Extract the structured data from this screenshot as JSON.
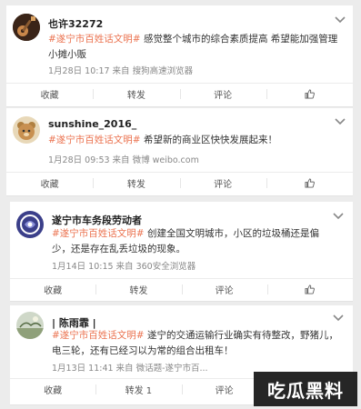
{
  "posts": [
    {
      "username": "也许32272",
      "tag": "#遂宁市百姓话文明#",
      "text": " 感觉整个城市的综合素质提高 希望能加强管理小摊小贩",
      "meta": "1月28日 10:17 来自 搜狗高速浏览器",
      "actions": {
        "favorite": "收藏",
        "repost": "转发",
        "comment": "评论"
      },
      "avatar_icon": "guitar-avatar-icon"
    },
    {
      "username": "sunshine_2016_",
      "tag": "#遂宁市百姓话文明#",
      "text": " 希望新的商业区快快发展起来！",
      "meta": "1月28日 09:53 来自 微博 weibo.com",
      "actions": {
        "favorite": "收藏",
        "repost": "转发",
        "comment": "评论"
      },
      "avatar_icon": "bear-avatar-icon"
    },
    {
      "username": "遂宁市车务段劳动者",
      "tag": "#遂宁市百姓话文明#",
      "text": " 创建全国文明城市，小区的垃圾桶还是偏少，还是存在乱丢垃圾的现象。",
      "meta": "1月14日 10:15 来自 360安全浏览器",
      "actions": {
        "favorite": "收藏",
        "repost": "转发",
        "comment": "评论"
      },
      "avatar_icon": "logo-avatar-icon"
    },
    {
      "username": "| 陈雨霏 |",
      "tag": "#遂宁市百姓话文明#",
      "text": " 遂宁的交通运输行业确实有待整改，野猪儿，电三轮，还有已经习以为常的组合出租车！",
      "meta": "1月13日 11:41 来自 微话题-遂宁市百...",
      "actions": {
        "favorite": "收藏",
        "repost": "转发 1",
        "comment": "评论"
      },
      "avatar_icon": "landscape-avatar-icon"
    }
  ],
  "watermark": "吃瓜黑料",
  "colors": {
    "tag": "#eb7350",
    "meta": "#888888",
    "background": "#ececec"
  }
}
